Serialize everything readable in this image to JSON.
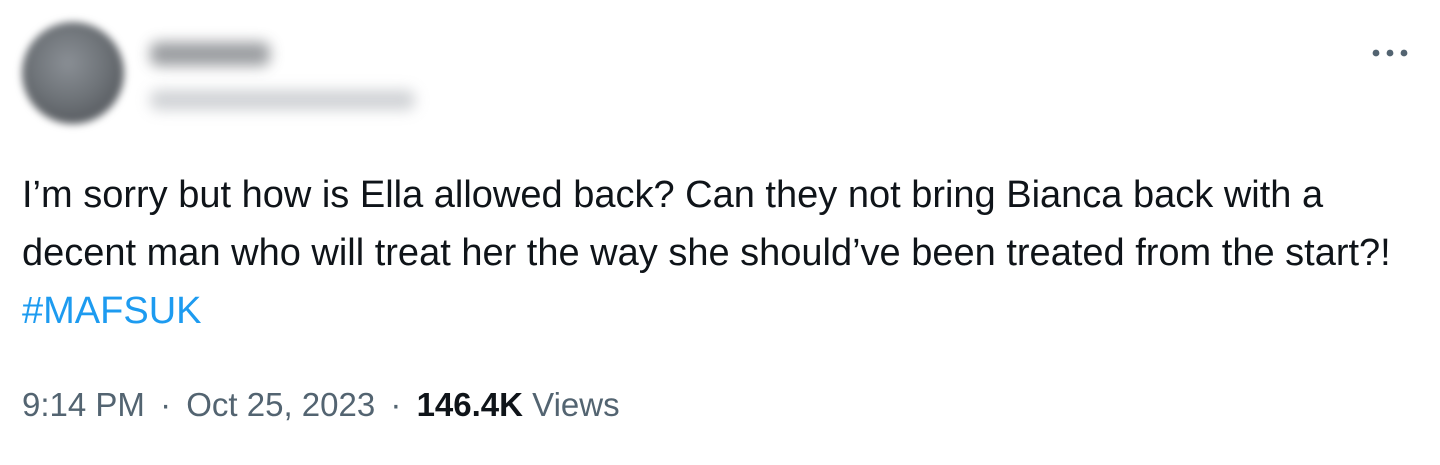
{
  "tweet": {
    "more_icon": "more-horizontal-icon",
    "text": "I’m sorry but how is Ella allowed back? Can they not bring Bianca back with a decent man who will treat her the way she should’ve been treated from the start?! ",
    "hashtag": "#MAFSUK",
    "hashtag_color": "#1d9bf0",
    "time": "9:14 PM",
    "date": "Oct 25, 2023",
    "separator": "·",
    "views_count": "146.4K",
    "views_label": "Views"
  }
}
